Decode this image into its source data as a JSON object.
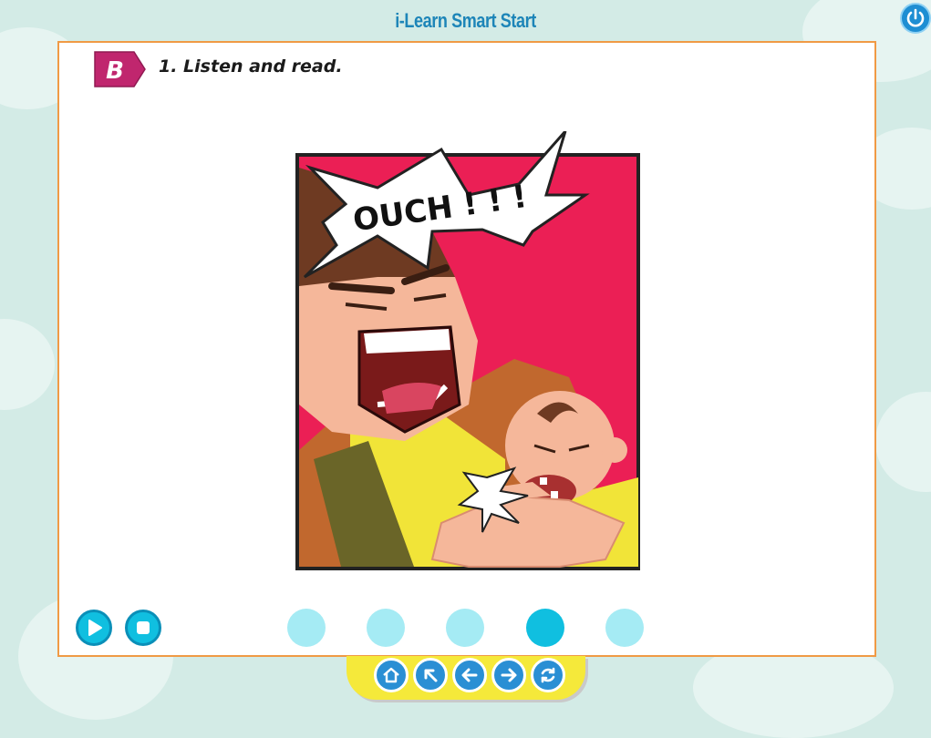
{
  "header": {
    "title": "i-Learn Smart Start"
  },
  "activity": {
    "section_letter": "B",
    "instruction": "1. Listen and read."
  },
  "comic": {
    "speech_text": "OUCH ! ! !"
  },
  "player": {
    "dots_count": 5,
    "active_dot_index": 3
  },
  "icons": {
    "power": "power-icon",
    "play": "play-icon",
    "stop": "stop-icon",
    "home": "home-icon",
    "up": "arrow-up-left-icon",
    "back": "arrow-left-icon",
    "forward": "arrow-right-icon",
    "refresh": "refresh-icon"
  },
  "colors": {
    "accent": "#1e8ed3",
    "panel_border": "#f09a45",
    "badge": "#c0266e",
    "nav_tray": "#f5e93a",
    "dot_inactive": "#a5ebf4",
    "dot_active": "#10bfe0"
  }
}
